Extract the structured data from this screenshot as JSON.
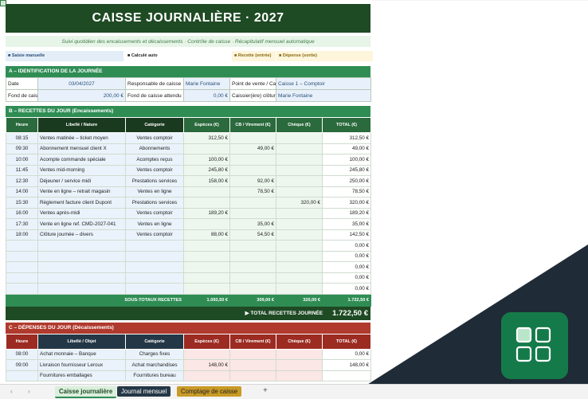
{
  "title": "CAISSE JOURNALIÈRE  ·  2027",
  "subtitle": "Suivi quotidien des encaissements et décaissements  ·  Contrôle de caisse  ·  Récapitulatif mensuel automatique",
  "legend": {
    "saisie": "■ Saisie manuelle",
    "calcule": "■ Calculé auto",
    "recette": "■ Recette (entrée)",
    "depense": "■ Dépense (sortie)"
  },
  "section_a": {
    "title": "A  –  IDENTIFICATION DE LA JOURNÉE",
    "rows": [
      [
        "Date",
        "03/04/2027",
        "Responsable de caisse",
        "Marie Fontaine",
        "Point de vente / Caisse",
        "Caisse 1 – Comptoir"
      ],
      [
        "Fond de caisse",
        "200,00 €",
        "Fond de caisse attendu",
        "0,00 €",
        "Caissier(ère) clôture",
        "Marie Fontaine"
      ]
    ]
  },
  "section_b": {
    "title": "B  –  RECETTES DU JOUR  (Encaissements)",
    "headers": [
      "Heure",
      "Libellé / Nature",
      "Catégorie",
      "Espèces (€)",
      "CB / Virement (€)",
      "Chèque (€)",
      "TOTAL (€)"
    ],
    "rows": [
      [
        "08:15",
        "Ventes matinée – ticket moyen",
        "Ventes comptoir",
        "312,50 €",
        "",
        "",
        "312,50 €"
      ],
      [
        "09:30",
        "Abonnement mensuel client X",
        "Abonnements",
        "",
        "49,00 €",
        "",
        "49,00 €"
      ],
      [
        "10:00",
        "Acompte commande spéciale",
        "Acomptes reçus",
        "100,00 €",
        "",
        "",
        "100,00 €"
      ],
      [
        "11:45",
        "Ventes mid-morning",
        "Ventes comptoir",
        "245,80 €",
        "",
        "",
        "245,80 €"
      ],
      [
        "12:30",
        "Déjeuner / service midi",
        "Prestations services",
        "158,00 €",
        "92,00 €",
        "",
        "250,00 €"
      ],
      [
        "14:00",
        "Vente en ligne – retrait magasin",
        "Ventes en ligne",
        "",
        "78,50 €",
        "",
        "78,50 €"
      ],
      [
        "15:30",
        "Règlement facture client Dupont",
        "Prestations services",
        "",
        "",
        "320,00 €",
        "320,00 €"
      ],
      [
        "16:00",
        "Ventes après-midi",
        "Ventes comptoir",
        "189,20 €",
        "",
        "",
        "189,20 €"
      ],
      [
        "17:30",
        "Vente en ligne ref. CMD-2027-041",
        "Ventes en ligne",
        "",
        "35,00 €",
        "",
        "35,00 €"
      ],
      [
        "18:00",
        "Clôture journée – divers",
        "Ventes comptoir",
        "88,00 €",
        "54,50 €",
        "",
        "142,50 €"
      ],
      [
        "",
        "",
        "",
        "",
        "",
        "",
        "0,00 €"
      ],
      [
        "",
        "",
        "",
        "",
        "",
        "",
        "0,00 €"
      ],
      [
        "",
        "",
        "",
        "",
        "",
        "",
        "0,00 €"
      ],
      [
        "",
        "",
        "",
        "",
        "",
        "",
        "0,00 €"
      ],
      [
        "",
        "",
        "",
        "",
        "",
        "",
        "0,00 €"
      ]
    ],
    "subtotal_label": "SOUS-TOTAUX RECETTES",
    "subtotals": [
      "1.093,50 €",
      "309,00 €",
      "320,00 €",
      "1.722,50 €"
    ],
    "grand_label": "▶  TOTAL RECETTES JOURNÉE",
    "grand_value": "1.722,50 €"
  },
  "section_c": {
    "title": "C  –  DÉPENSES DU JOUR  (Décaissements)",
    "headers": [
      "Heure",
      "Libellé / Objet",
      "Catégorie",
      "Espèces (€)",
      "CB / Virement (€)",
      "Chèque (€)",
      "TOTAL (€)"
    ],
    "rows": [
      [
        "08:00",
        "Achat monnaie – Banque",
        "Charges fixes",
        "",
        "",
        "",
        "0,00 €"
      ],
      [
        "09:00",
        "Livraison fournisseur Leroux",
        "Achat marchandises",
        "148,00 €",
        "",
        "",
        "148,00 €"
      ],
      [
        "",
        "Fournitures emballages",
        "Fournitures bureau",
        "",
        "",
        "",
        ""
      ]
    ]
  },
  "tabs": [
    "Caisse journalière",
    "Journal mensuel",
    "Comptage de caisse"
  ],
  "tab_add": "+",
  "nav": [
    "‹",
    "›"
  ],
  "colors": {
    "dark_green": "#1e4a24",
    "green": "#2f8d54",
    "red": "#b03a2e",
    "navy": "#243746",
    "logo": "#157a4a"
  }
}
